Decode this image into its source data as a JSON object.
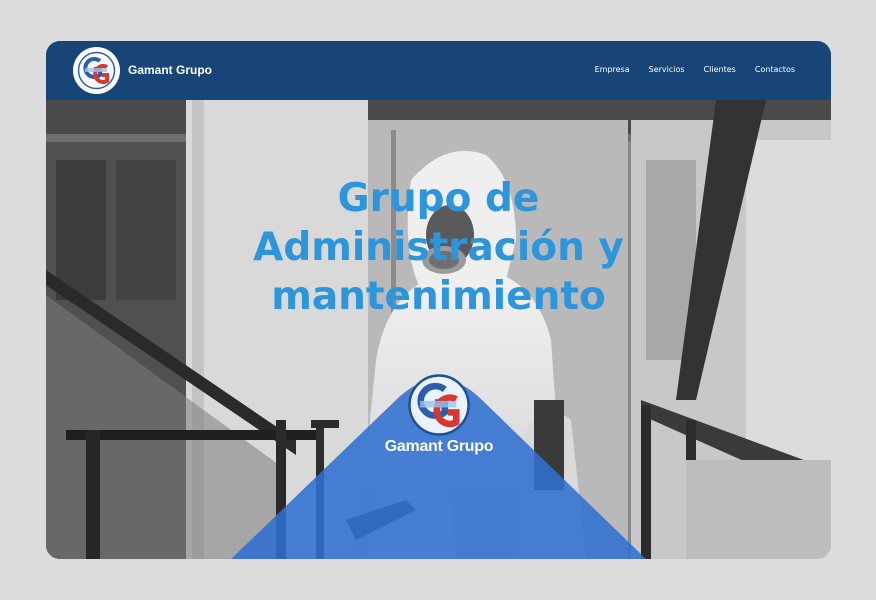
{
  "brand": {
    "name": "Gamant Grupo",
    "logo_letters": "GG"
  },
  "nav": {
    "items": [
      {
        "label": "Empresa"
      },
      {
        "label": "Servicios"
      },
      {
        "label": "Clientes"
      },
      {
        "label": "Contactos"
      }
    ]
  },
  "hero": {
    "headline_lines": [
      "Grupo de",
      "Administración y",
      "mantenimiento"
    ],
    "badge_name": "Gamant Grupo"
  },
  "colors": {
    "navbar": "#174577",
    "headline": "#2d95dc",
    "badge": "#2f6fcf",
    "logo_red": "#d8382e",
    "logo_blue": "#2a5fb0"
  },
  "icons": {
    "logo": "gamant-logo-icon"
  }
}
